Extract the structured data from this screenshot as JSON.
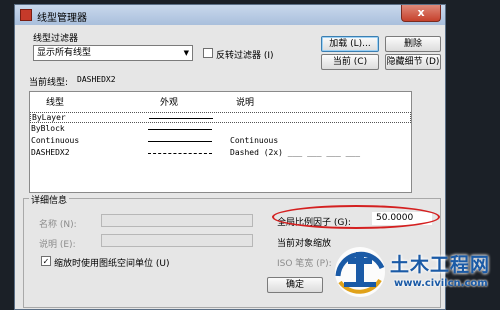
{
  "dialog": {
    "title": "线型管理器",
    "close_label": "x"
  },
  "filter": {
    "group_label": "线型过滤器",
    "selected": "显示所有线型",
    "invert_label": "反转过滤器 (I)",
    "invert_checked": false
  },
  "buttons": {
    "load": "加载 (L)...",
    "delete": "删除",
    "current": "当前 (C)",
    "hide_details": "隐藏细节 (D)",
    "ok": "确定"
  },
  "current_linetype": {
    "label": "当前线型:",
    "value": "DASHEDX2"
  },
  "list": {
    "headers": [
      "线型",
      "外观",
      "说明"
    ],
    "rows": [
      {
        "name": "ByLayer",
        "appearance": "solid",
        "desc": ""
      },
      {
        "name": "ByBlock",
        "appearance": "solid",
        "desc": ""
      },
      {
        "name": "Continuous",
        "appearance": "solid",
        "desc": "Continuous"
      },
      {
        "name": "DASHEDX2",
        "appearance": "dashed",
        "desc": "Dashed (2x) ___ ___ ___ ___"
      }
    ]
  },
  "details": {
    "group_label": "详细信息",
    "name_label": "名称 (N):",
    "desc_label": "说明 (E):",
    "paper_space_label": "缩放时使用图纸空间单位 (U)",
    "paper_space_checked": true,
    "global_scale_label": "全局比例因子 (G):",
    "global_scale_value": "50.0000",
    "current_scale_label": "当前对象缩放",
    "iso_label": "ISO 笔宽 (P):"
  },
  "watermark": {
    "text": "土木工程网",
    "url": "www.civilcn.com"
  }
}
